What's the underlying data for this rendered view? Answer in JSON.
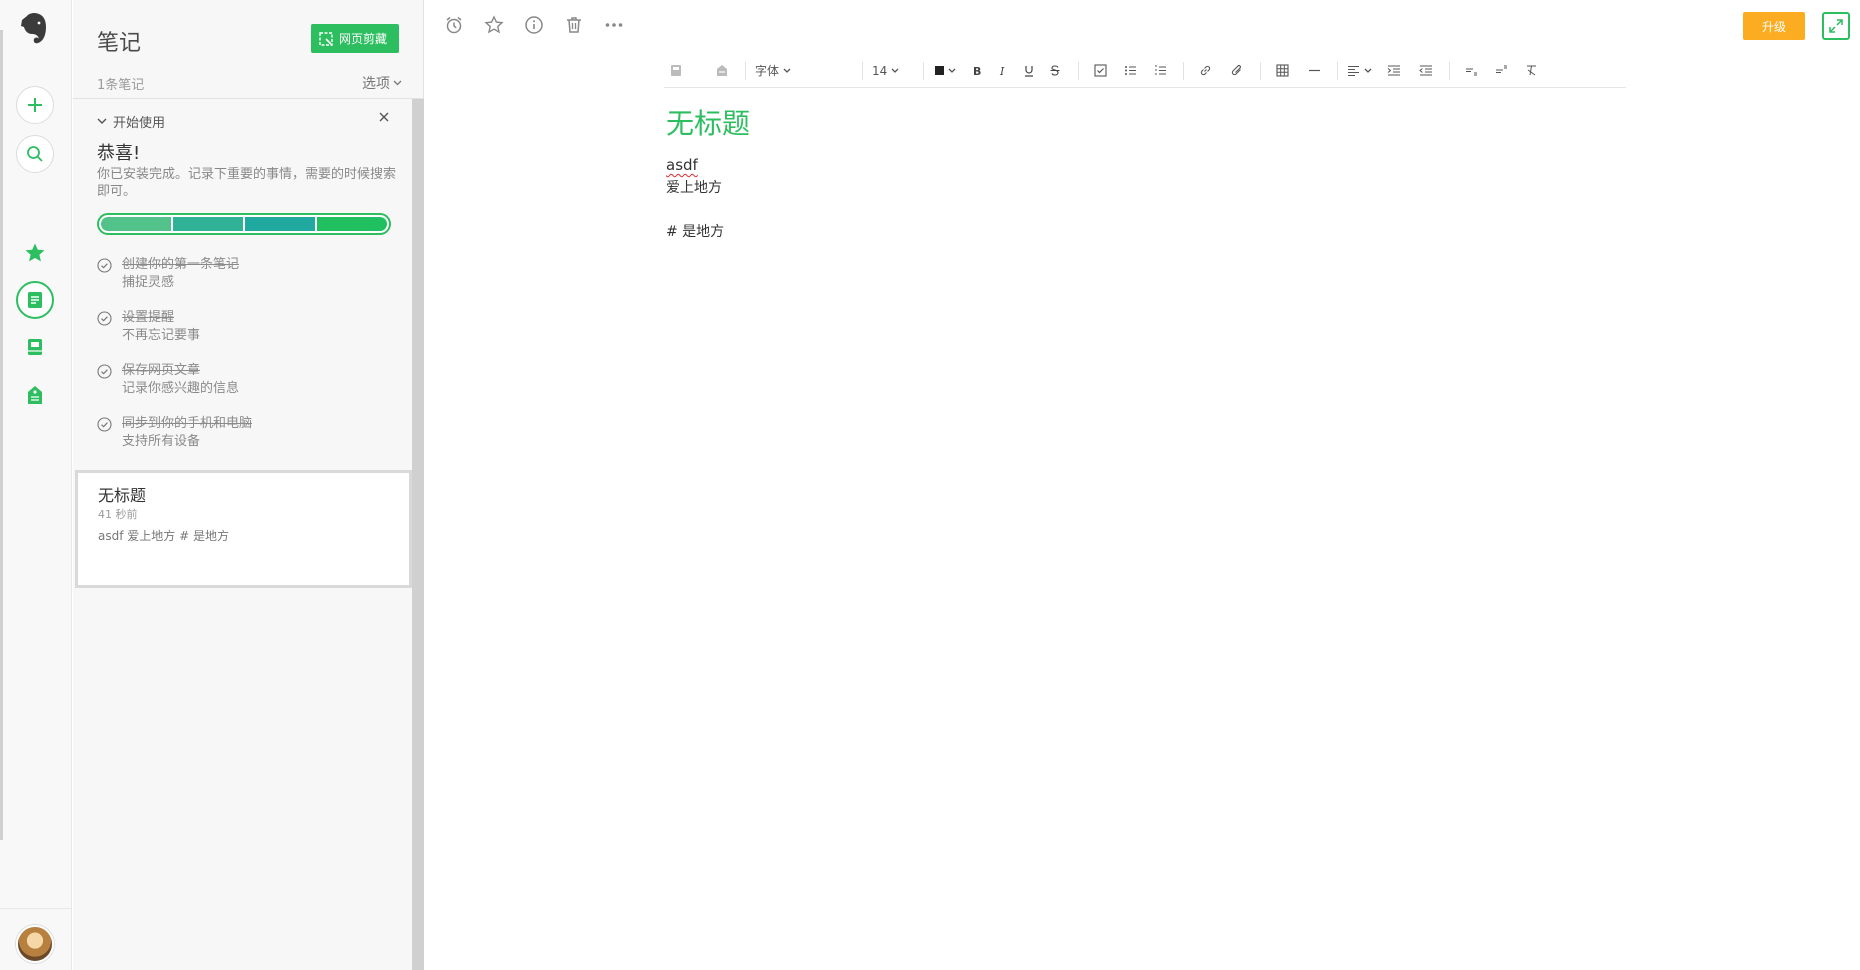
{
  "rail": {
    "icons": [
      "evernote-logo-icon",
      "plus-icon",
      "search-icon",
      "star-icon",
      "note-icon",
      "notebook-icon",
      "tag-icon"
    ],
    "accent": "#2dbe60"
  },
  "panel": {
    "title": "笔记",
    "clip_button": "网页剪藏",
    "note_count": "1条笔记",
    "options": "选项",
    "getting_started": {
      "header": "开始使用",
      "title": "恭喜!",
      "desc": "你已安装完成。记录下重要的事情，需要的时候搜索即可。",
      "progress_completed": 4,
      "progress_total": 4,
      "segment_colors": [
        "#52c28a",
        "#2fb295",
        "#1fa99f",
        "#20c060"
      ],
      "tasks": [
        {
          "title": "创建你的第一条笔记",
          "subtitle": "捕捉灵感"
        },
        {
          "title": "设置提醒",
          "subtitle": "不再忘记要事"
        },
        {
          "title": "保存网页文章",
          "subtitle": "记录你感兴趣的信息"
        },
        {
          "title": "同步到你的手机和电脑",
          "subtitle": "支持所有设备"
        }
      ]
    },
    "notes": [
      {
        "title": "无标题",
        "time": "41 秒前",
        "preview": "asdf 爱上地方 # 是地方"
      }
    ]
  },
  "header": {
    "actions": [
      "reminder-icon",
      "star-icon",
      "info-icon",
      "trash-icon",
      "more-icon"
    ],
    "upgrade": "升级",
    "upgrade_color": "#fcac21"
  },
  "toolbar": {
    "font": "字体",
    "size": "14"
  },
  "editor": {
    "title": "无标题",
    "lines": [
      "asdf",
      "爱上地方",
      "",
      "# 是地方"
    ]
  }
}
